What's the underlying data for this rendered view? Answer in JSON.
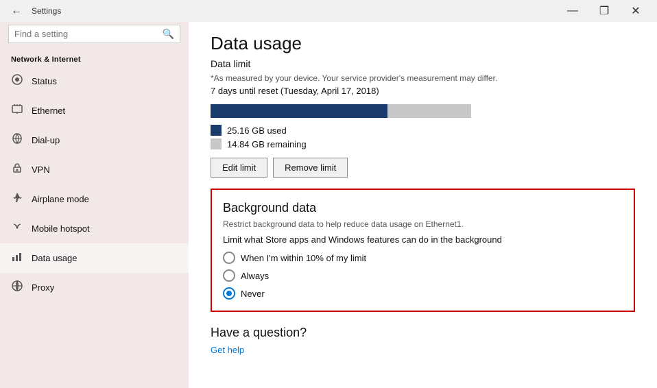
{
  "titlebar": {
    "title": "Settings",
    "minimize": "—",
    "maximize": "❐",
    "close": "✕"
  },
  "sidebar": {
    "section_title": "Network & Internet",
    "search_placeholder": "Find a setting",
    "items": [
      {
        "id": "status",
        "label": "Status",
        "icon": "⊙"
      },
      {
        "id": "ethernet",
        "label": "Ethernet",
        "icon": "🖧"
      },
      {
        "id": "dialup",
        "label": "Dial-up",
        "icon": "📞"
      },
      {
        "id": "vpn",
        "label": "VPN",
        "icon": "🔒"
      },
      {
        "id": "airplane",
        "label": "Airplane mode",
        "icon": "✈"
      },
      {
        "id": "hotspot",
        "label": "Mobile hotspot",
        "icon": "📡"
      },
      {
        "id": "datausage",
        "label": "Data usage",
        "icon": "📊"
      },
      {
        "id": "proxy",
        "label": "Proxy",
        "icon": "⚙"
      }
    ]
  },
  "main": {
    "page_title": "Data usage",
    "data_limit_heading": "Data limit",
    "note": "*As measured by your device. Your service provider's measurement may differ.",
    "reset_info": "7 days until reset (Tuesday, April 17, 2018)",
    "progress_percent": 68,
    "used_label": "25.16 GB used",
    "remaining_label": "14.84 GB remaining",
    "edit_button": "Edit limit",
    "remove_button": "Remove limit",
    "bg_data": {
      "title": "Background data",
      "desc": "Restrict background data to help reduce data usage on Ethernet1.",
      "limit_text": "Limit what Store apps and Windows features can do in the background",
      "options": [
        {
          "id": "within10",
          "label": "When I'm within 10% of my limit",
          "checked": false
        },
        {
          "id": "always",
          "label": "Always",
          "checked": false
        },
        {
          "id": "never",
          "label": "Never",
          "checked": true
        }
      ]
    },
    "have_question": "Have a question?",
    "get_help": "Get help"
  }
}
